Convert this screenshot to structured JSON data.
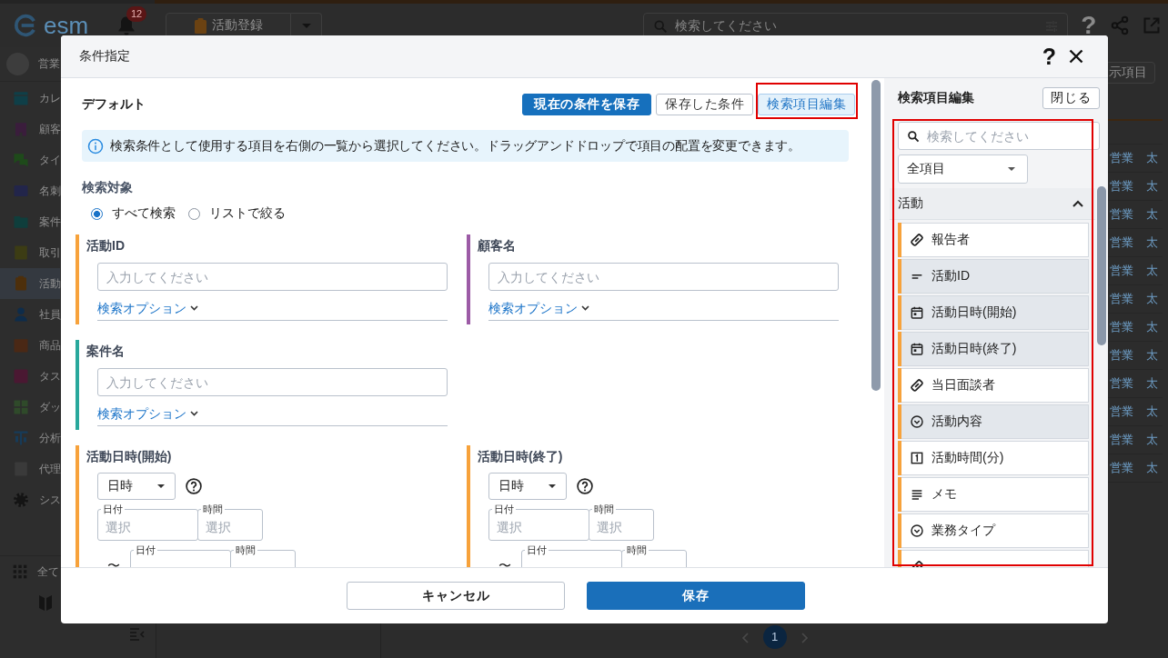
{
  "app": {
    "logo": "esm",
    "notifications": "12",
    "create_button": {
      "label": "活動登録"
    },
    "search": {
      "placeholder": "検索してください"
    },
    "help": "?",
    "sidebar": {
      "user": "営業",
      "items": [
        {
          "label": "カレ",
          "color": "#0f3f48",
          "selected": false
        },
        {
          "label": "顧客",
          "color": "#3a1d3c",
          "selected": false
        },
        {
          "label": "タイ",
          "color": "#1e4a1a",
          "selected": false
        },
        {
          "label": "名刺",
          "color": "#22254a",
          "selected": false
        },
        {
          "label": "案件",
          "color": "#0f3e3c",
          "selected": false
        },
        {
          "label": "取引",
          "color": "#3c3c14",
          "selected": false
        },
        {
          "label": "活動",
          "color": "#4d2f0b",
          "selected": true
        },
        {
          "label": "社員",
          "color": "#0e2c4a",
          "selected": false
        },
        {
          "label": "商品",
          "color": "#4a2815",
          "selected": false
        },
        {
          "label": "タス",
          "color": "#4a1832",
          "selected": false
        },
        {
          "label": "ダッ",
          "color": "#2f4a2a",
          "selected": false
        },
        {
          "label": "分析",
          "color": "#173b58",
          "selected": false
        },
        {
          "label": "代理",
          "color": "#3a3a3a",
          "selected": false
        },
        {
          "label": "シス",
          "color": "#141414",
          "selected": false
        }
      ],
      "all_menu": "全て"
    },
    "columns_button": "示項目",
    "table": {
      "rows": [
        [
          "営業",
          "太"
        ],
        [
          "営業",
          "太"
        ],
        [
          "営業",
          "太"
        ],
        [
          "営業",
          "太"
        ],
        [
          "営業",
          "太"
        ],
        [
          "営業",
          "太"
        ],
        [
          "営業",
          "太"
        ],
        [
          "営業",
          "太"
        ],
        [
          "営業",
          "太"
        ],
        [
          "営業",
          "太"
        ],
        [
          "営業",
          "太"
        ],
        [
          "営業",
          "太"
        ]
      ]
    },
    "pagination": {
      "pages": [
        {
          "label": "1",
          "selected": true
        }
      ]
    }
  },
  "dialog": {
    "title": "条件指定",
    "help_button": "?",
    "preset": "デフォルト",
    "actions": [
      {
        "label": "現在の条件を保存",
        "kind": "primary"
      },
      {
        "label": "保存した条件",
        "kind": "default"
      },
      {
        "label": "検索項目編集",
        "kind": "toggle",
        "on": true
      }
    ],
    "info": "検索条件として使用する項目を右側の一覧から選択してください。ドラッグアンドドロップで項目の配置を変更できます。",
    "target": {
      "label": "検索対象",
      "options": [
        {
          "label": "すべて検索",
          "selected": true
        },
        {
          "label": "リストで絞る",
          "selected": false
        }
      ]
    },
    "field_rows": [
      [
        {
          "kind": "text",
          "label": "活動ID",
          "color": "#f7a23b",
          "placeholder": "入力してください",
          "option_link": "検索オプション"
        },
        {
          "kind": "text",
          "label": "顧客名",
          "color": "#9c5ba6",
          "placeholder": "入力してください",
          "option_link": "検索オプション"
        }
      ],
      [
        {
          "kind": "text",
          "label": "案件名",
          "color": "#29a89c",
          "placeholder": "入力してください",
          "option_link": "検索オプション"
        }
      ],
      [
        {
          "kind": "datetime",
          "label": "活動日時(開始)",
          "color": "#f7a23b",
          "mode": "日時",
          "range": [
            {
              "date_label": "日付",
              "date_placeholder": "選択",
              "time_label": "時間",
              "time_placeholder": "選択"
            },
            {
              "prefix": "〜",
              "date_label": "日付",
              "time_label": "時間"
            }
          ]
        },
        {
          "kind": "datetime",
          "label": "活動日時(終了)",
          "color": "#f7a23b",
          "mode": "日時",
          "range": [
            {
              "date_label": "日付",
              "date_placeholder": "選択",
              "time_label": "時間",
              "time_placeholder": "選択"
            },
            {
              "prefix": "〜",
              "date_label": "日付",
              "time_label": "時間"
            }
          ]
        }
      ]
    ],
    "panel": {
      "title": "検索項目編集",
      "close_button": "閉じる",
      "search": {
        "placeholder": "検索してください"
      },
      "filter": {
        "value": "全項目"
      },
      "groups": [
        {
          "label": "活動",
          "expanded": true,
          "color": "#f7a23b",
          "items": [
            {
              "label": "報告者",
              "kind": "user",
              "selected": false
            },
            {
              "label": "活動ID",
              "kind": "text",
              "selected": true
            },
            {
              "label": "活動日時(開始)",
              "kind": "date",
              "selected": true
            },
            {
              "label": "活動日時(終了)",
              "kind": "date",
              "selected": true
            },
            {
              "label": "当日面談者",
              "kind": "user",
              "selected": false
            },
            {
              "label": "活動内容",
              "kind": "select",
              "selected": true
            },
            {
              "label": "活動時間(分)",
              "kind": "number",
              "selected": false
            },
            {
              "label": "メモ",
              "kind": "textarea",
              "selected": false
            },
            {
              "label": "業務タイプ",
              "kind": "select",
              "selected": false
            },
            {
              "kind": "user",
              "selected": false
            }
          ]
        }
      ]
    },
    "footer": [
      {
        "label": "キャンセル",
        "kind": "secondary"
      },
      {
        "label": "保存",
        "kind": "primary"
      }
    ]
  }
}
